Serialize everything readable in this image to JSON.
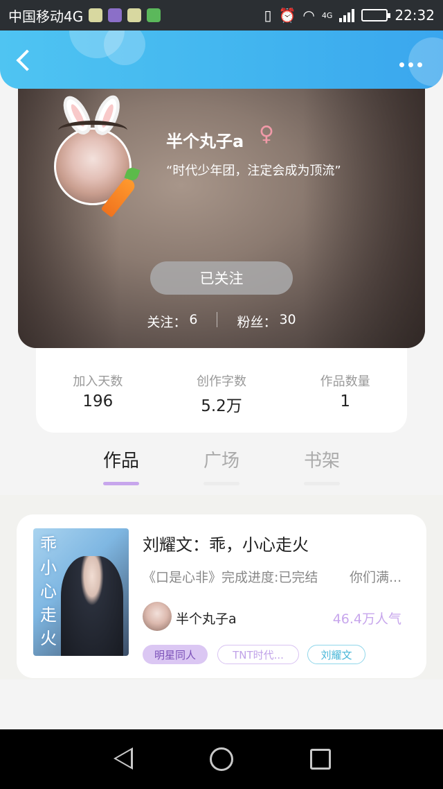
{
  "status_bar": {
    "carrier": "中国移动4G",
    "network": "4G",
    "time": "22:32"
  },
  "header": {
    "back_icon": "back-chevron-icon",
    "more_icon": "more-dots-icon"
  },
  "profile": {
    "nickname": "半个丸子a",
    "gender_symbol": "♀",
    "motto": "“时代少年团，注定会成为顶流”",
    "follow_button": "已关注",
    "following_label": "关注：",
    "following_count": "6",
    "fans_label": "粉丝：",
    "fans_count": "30"
  },
  "stats": [
    {
      "label": "加入天数",
      "value": "196"
    },
    {
      "label": "创作字数",
      "value": "5.2万"
    },
    {
      "label": "作品数量",
      "value": "1"
    }
  ],
  "tabs": [
    {
      "label": "作品",
      "active": true
    },
    {
      "label": "广场",
      "active": false
    },
    {
      "label": "书架",
      "active": false
    }
  ],
  "work": {
    "cover_text": "乖小心走火",
    "title": "刘耀文：乖，小心走火",
    "desc": "《口是心非》完成进度:已完结",
    "desc_extra": "你们满...",
    "author": "半个丸子a",
    "popularity": "46.4万人气",
    "tags": [
      "明星同人",
      "TNT时代...",
      "刘耀文"
    ]
  },
  "colors": {
    "header_blue": "#41b4ef",
    "accent_purple": "#c7a6ec",
    "accent_cyan": "#49b7d8"
  }
}
